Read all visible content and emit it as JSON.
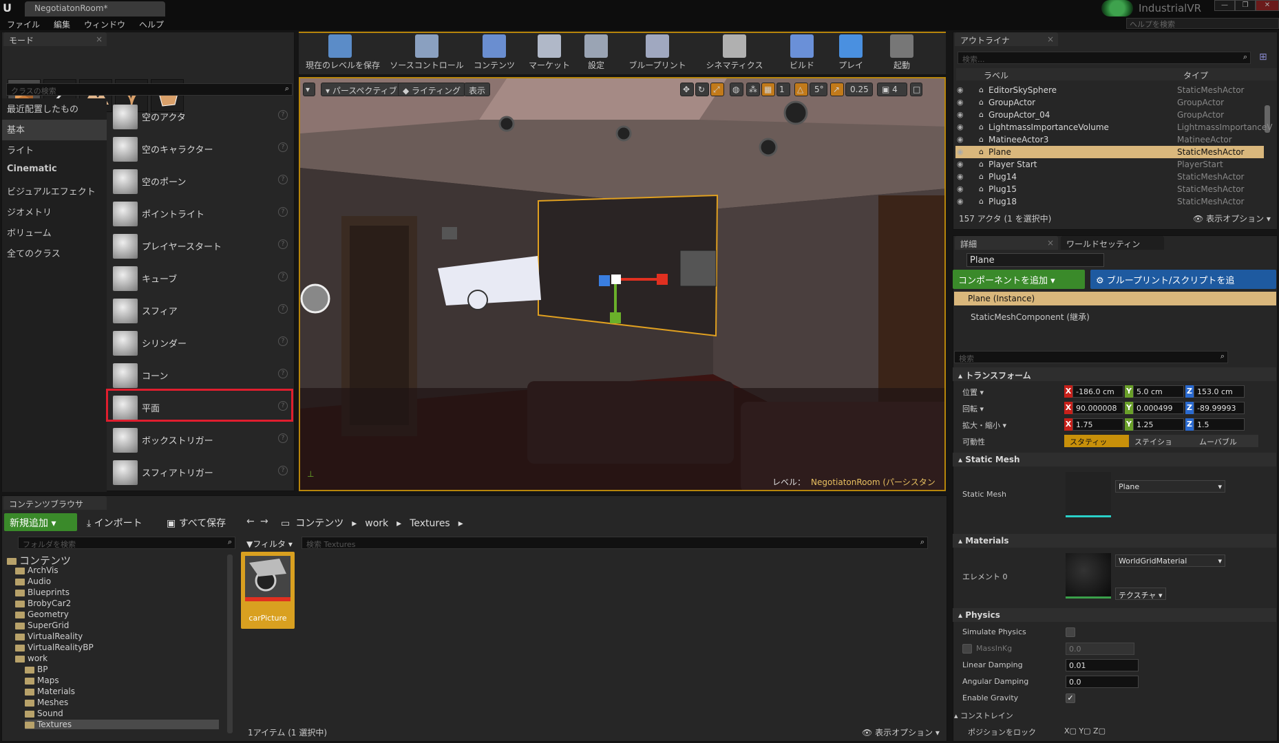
{
  "window": {
    "tab_title": "NegotiatonRoom*",
    "project": "IndustrialVR",
    "help_placeholder": "ヘルプを検索",
    "minimize": "—",
    "maximize": "❐",
    "close": "✕"
  },
  "menu": [
    "ファイル",
    "編集",
    "ウィンドウ",
    "ヘルプ"
  ],
  "modes": {
    "tab": "モード",
    "search_placeholder": "クラスの検索",
    "categories": [
      "最近配置したもの",
      "基本",
      "ライト",
      "Cinematic",
      "ビジュアルエフェクト",
      "ジオメトリ",
      "ボリューム",
      "全てのクラス"
    ],
    "classes": [
      "空のアクタ",
      "空のキャラクター",
      "空のポーン",
      "ポイントライト",
      "プレイヤースタート",
      "キューブ",
      "スフィア",
      "シリンダー",
      "コーン",
      "平面",
      "ボックストリガー",
      "スフィアトリガー"
    ],
    "help_glyph": "?"
  },
  "toolbar": [
    {
      "label": "現在のレベルを保存",
      "icon": "save-icon"
    },
    {
      "label": "ソースコントロール",
      "icon": "source-control-icon"
    },
    {
      "label": "コンテンツ",
      "icon": "content-icon"
    },
    {
      "label": "マーケット",
      "icon": "marketplace-icon"
    },
    {
      "label": "設定",
      "icon": "settings-icon"
    },
    {
      "label": "ブループリント",
      "icon": "blueprint-icon"
    },
    {
      "label": "シネマティクス",
      "icon": "cinematics-icon"
    },
    {
      "label": "ビルド",
      "icon": "build-icon"
    },
    {
      "label": "プレイ",
      "icon": "play-icon"
    },
    {
      "label": "起動",
      "icon": "launch-icon"
    }
  ],
  "viewport": {
    "perspective": "パースペクティブ",
    "lighting": "ライティング",
    "show": "表示",
    "snap_rot": "5°",
    "snap_scale": "0.25",
    "cam_speed": "4",
    "level_label": "レベル：",
    "level_name": "NegotiatonRoom (パーシスタント)"
  },
  "outliner": {
    "tab": "アウトライナ",
    "search_placeholder": "検索...",
    "col_label": "ラベル",
    "col_type": "タイプ",
    "rows": [
      {
        "label": "EditorSkySphere",
        "type": "StaticMeshActor"
      },
      {
        "label": "GroupActor",
        "type": "GroupActor"
      },
      {
        "label": "GroupActor_04",
        "type": "GroupActor"
      },
      {
        "label": "LightmassImportanceVolume",
        "type": "LightmassImportanceV"
      },
      {
        "label": "MatineeActor3",
        "type": "MatineeActor"
      },
      {
        "label": "Plane",
        "type": "StaticMeshActor"
      },
      {
        "label": "Player Start",
        "type": "PlayerStart"
      },
      {
        "label": "Plug14",
        "type": "StaticMeshActor"
      },
      {
        "label": "Plug15",
        "type": "StaticMeshActor"
      },
      {
        "label": "Plug18",
        "type": "StaticMeshActor"
      }
    ],
    "footer": "157 アクタ (1 を選択中)",
    "view_options": "表示オプション"
  },
  "details": {
    "tab_details": "詳細",
    "tab_world": "ワールドセッティン",
    "name": "Plane",
    "add_component": "コンポーネントを追加",
    "blueprint_script": "ブループリント/スクリプトを追",
    "instance": "Plane (Instance)",
    "component": "StaticMeshComponent (継承)",
    "search_placeholder": "検索",
    "transform": "トランスフォーム",
    "location": "位置",
    "rotation": "回転",
    "scale": "拡大・縮小",
    "mobility": "可動性",
    "loc": [
      "-186.0 cm",
      "5.0 cm",
      "153.0 cm"
    ],
    "rot": [
      "90.000008",
      "0.000499",
      "-89.99993"
    ],
    "scl": [
      "1.75",
      "1.25",
      "1.5"
    ],
    "mob": [
      "スタティッ",
      "ステイショ",
      "ムーバブル"
    ],
    "static_mesh_section": "Static Mesh",
    "static_mesh_label": "Static Mesh",
    "static_mesh_value": "Plane",
    "materials_section": "Materials",
    "element0": "エレメント 0",
    "material_value": "WorldGridMaterial",
    "texture_btn": "テクスチャ",
    "physics_section": "Physics",
    "simulate_physics": "Simulate Physics",
    "mass_in_kg": "MassInKg",
    "mass_value": "0.0",
    "linear_damping": "Linear Damping",
    "linear_value": "0.01",
    "angular_damping": "Angular Damping",
    "angular_value": "0.0",
    "enable_gravity": "Enable Gravity",
    "constraints": "コンストレイン",
    "lock_position": "ポジションをロック"
  },
  "content": {
    "tab": "コンテンツブラウサ",
    "add_new": "新規追加",
    "import": "インポート",
    "save_all": "すべて保存",
    "crumbs": [
      "コンテンツ",
      "work",
      "Textures"
    ],
    "folder_search": "フォルダを検索",
    "filter": "フィルタ",
    "search_placeholder": "検索 Textures",
    "tree": [
      {
        "label": "コンテンツ",
        "depth": 0
      },
      {
        "label": "ArchVis",
        "depth": 1
      },
      {
        "label": "Audio",
        "depth": 1
      },
      {
        "label": "Blueprints",
        "depth": 1
      },
      {
        "label": "BrobyCar2",
        "depth": 1
      },
      {
        "label": "Geometry",
        "depth": 1
      },
      {
        "label": "SuperGrid",
        "depth": 1
      },
      {
        "label": "VirtualReality",
        "depth": 1
      },
      {
        "label": "VirtualRealityBP",
        "depth": 1
      },
      {
        "label": "work",
        "depth": 1
      },
      {
        "label": "BP",
        "depth": 2
      },
      {
        "label": "Maps",
        "depth": 2
      },
      {
        "label": "Materials",
        "depth": 2
      },
      {
        "label": "Meshes",
        "depth": 2
      },
      {
        "label": "Sound",
        "depth": 2
      },
      {
        "label": "Textures",
        "depth": 2
      }
    ],
    "asset_name": "carPicture",
    "footer": "1アイテム (1 選択中)",
    "view_options": "表示オプション"
  }
}
